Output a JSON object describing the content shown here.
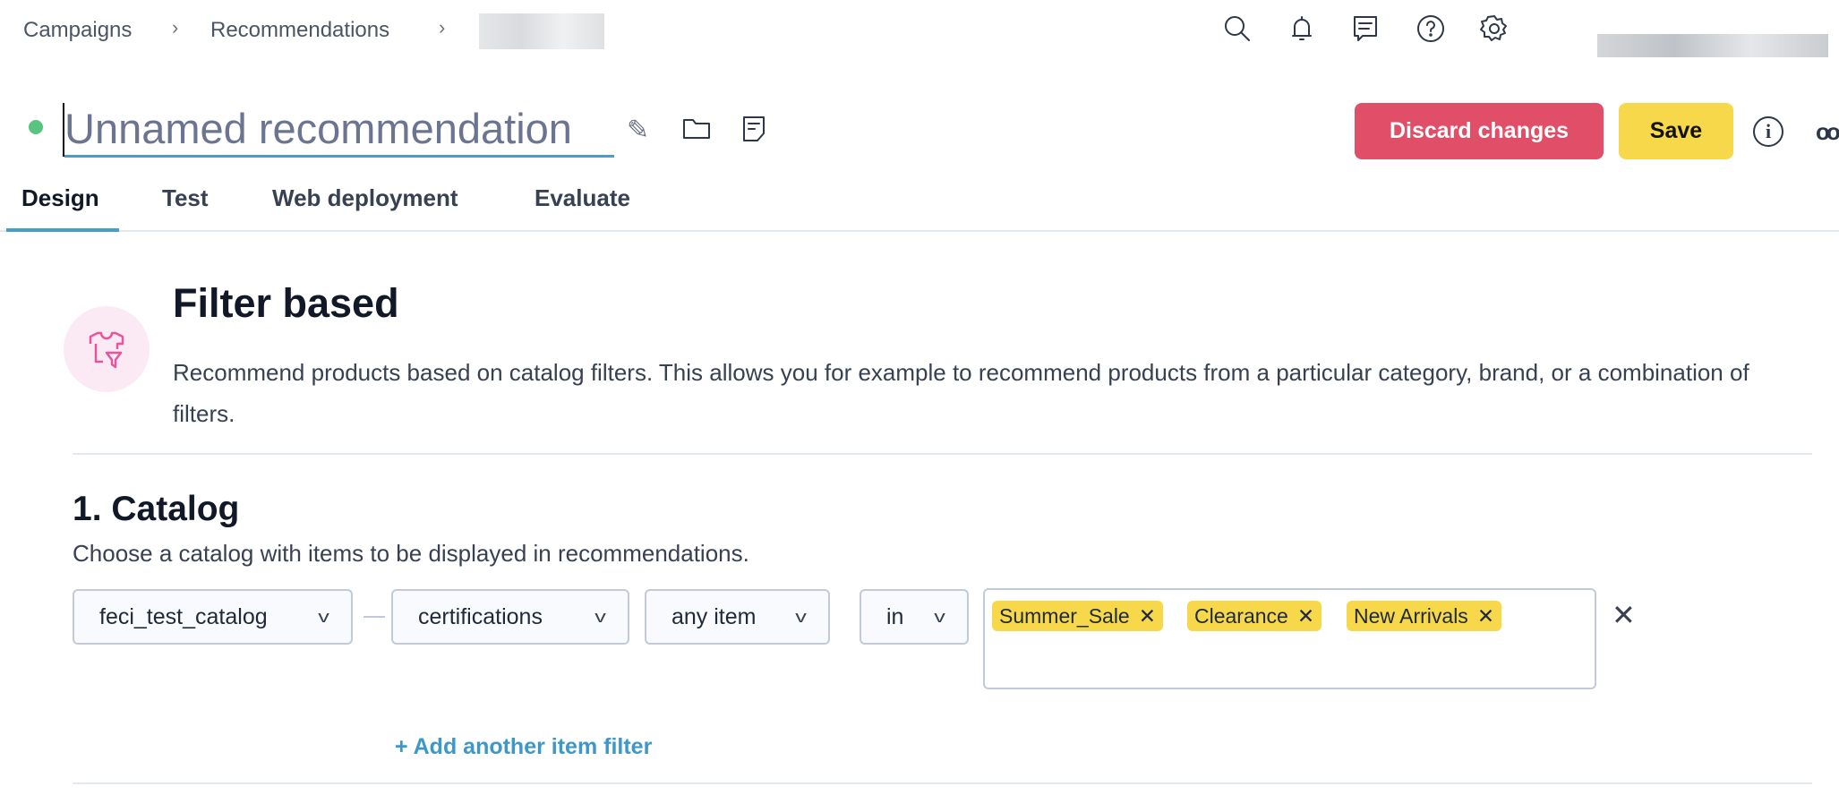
{
  "breadcrumb": {
    "items": [
      "Campaigns",
      "Recommendations"
    ],
    "separator": "›"
  },
  "header_icons": [
    "search-icon",
    "bell-icon",
    "chat-icon",
    "help-icon",
    "gear-icon"
  ],
  "title": {
    "value": "Unnamed recommendation",
    "status_color": "#57c47f"
  },
  "actions": {
    "discard": "Discard changes",
    "save": "Save",
    "discard_color": "#e04f67",
    "save_color": "#f7d84a"
  },
  "tabs": [
    "Design",
    "Test",
    "Web deployment",
    "Evaluate"
  ],
  "active_tab": "Design",
  "intro": {
    "heading": "Filter based",
    "description": "Recommend products based on catalog filters. This allows you for example to recommend products from a particular category, brand, or a combination of filters."
  },
  "catalog": {
    "heading": "1. Catalog",
    "subtitle": "Choose a catalog with items to be displayed in recommendations.",
    "catalog_select": "feci_test_catalog",
    "attribute_select": "certifications",
    "quantifier_select": "any item",
    "operator_select": "in",
    "tags": [
      "Summer_Sale",
      "Clearance",
      "New Arrivals"
    ],
    "add_filter": "+ Add another item filter"
  }
}
